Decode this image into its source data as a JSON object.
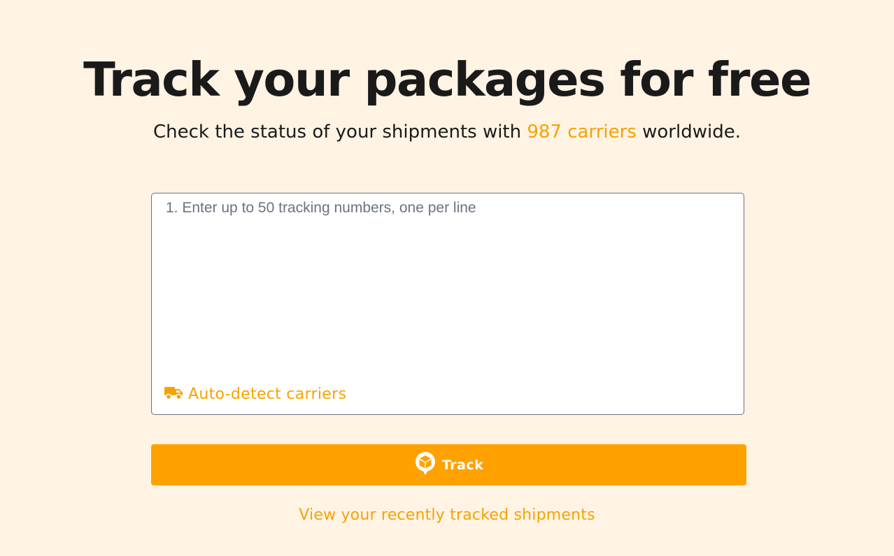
{
  "header": {
    "title": "Track your packages for free",
    "subtitle_before": "Check the status of your shipments with ",
    "subtitle_link": "987 carriers",
    "subtitle_after": " worldwide."
  },
  "tracking_input": {
    "value": "",
    "placeholder": "1. Enter up to 50 tracking numbers, one per line",
    "auto_detect_label": "Auto-detect carriers",
    "auto_detect_icon": "truck-icon"
  },
  "track_button": {
    "label": "Track",
    "icon": "package-icon"
  },
  "recent_link": "View your recently tracked shipments",
  "colors": {
    "background": "#fff3e4",
    "accent": "#ffa200",
    "link": "#f5a300",
    "text": "#1a1a1a"
  }
}
